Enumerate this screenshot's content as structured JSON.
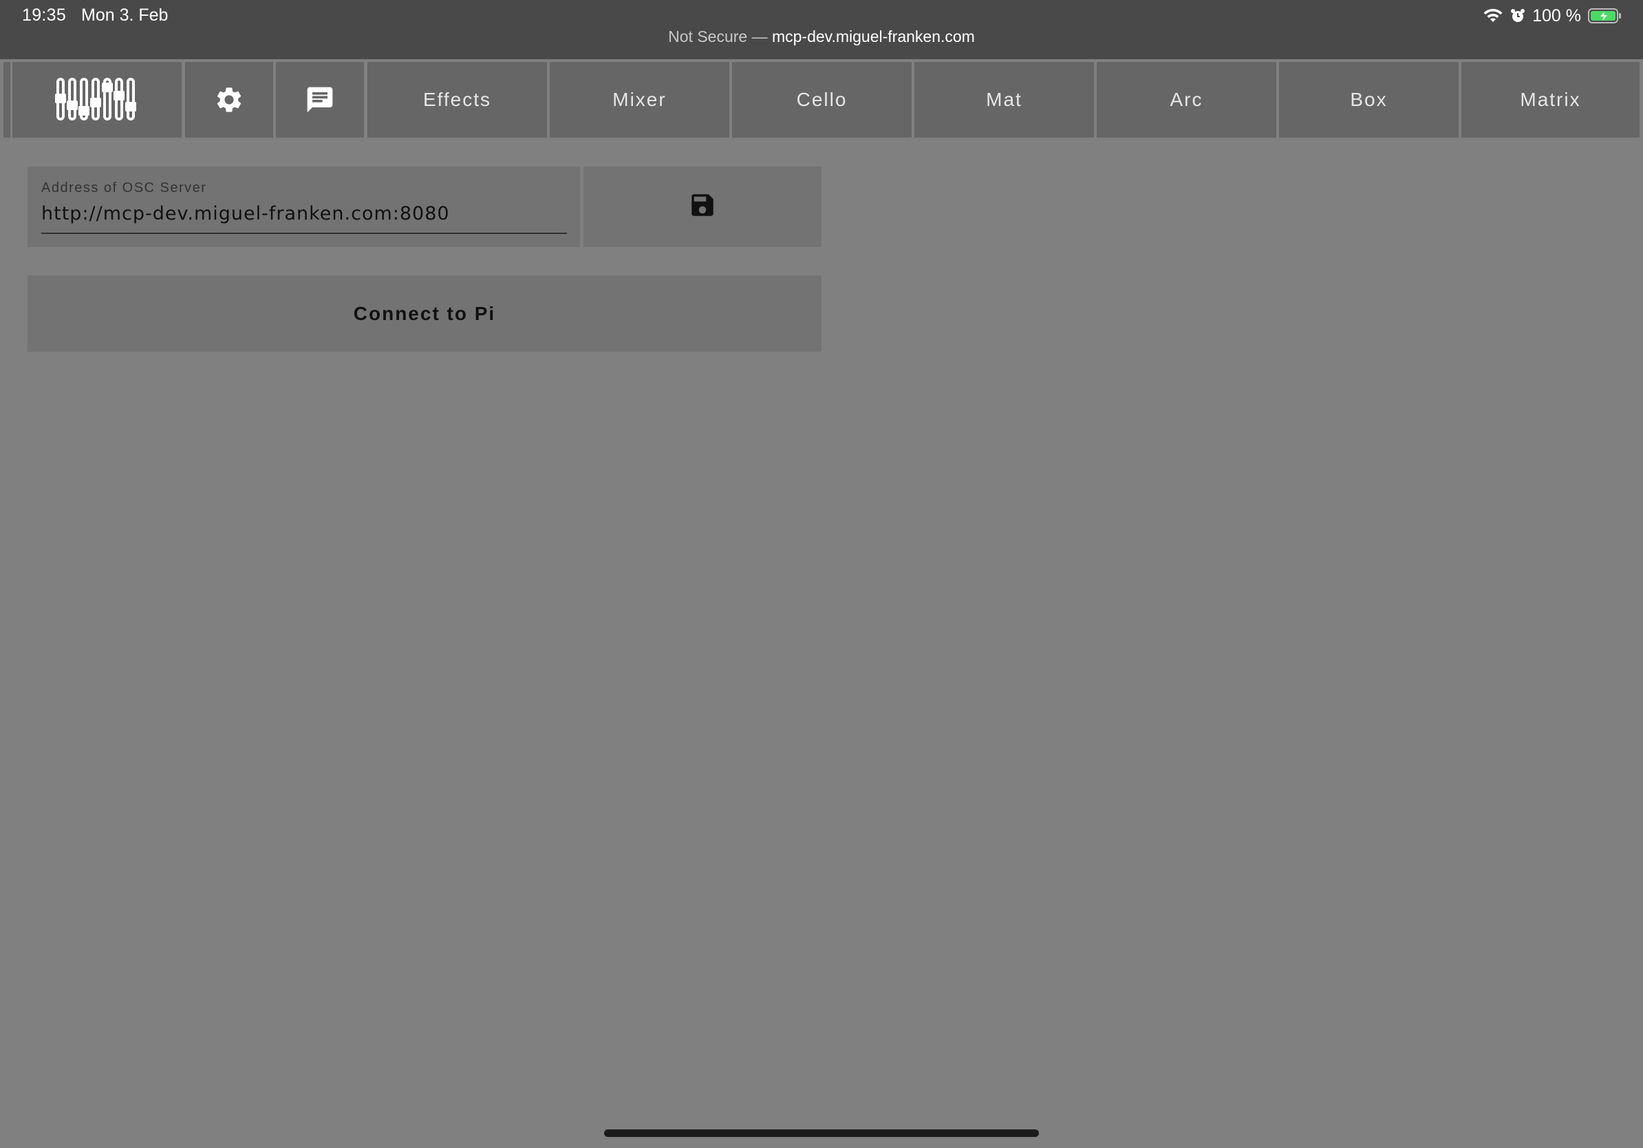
{
  "status_bar": {
    "time": "19:35",
    "date": "Mon 3. Feb",
    "security": "Not Secure —",
    "domain": "mcp-dev.miguel-franken.com",
    "battery": "100 %"
  },
  "nav": {
    "logo_icon": "mixer-faders-icon",
    "settings_icon": "gear-icon",
    "messages_icon": "chat-icon",
    "tabs": [
      "Effects",
      "Mixer",
      "Cello",
      "Mat",
      "Arc",
      "Box",
      "Matrix"
    ]
  },
  "settings": {
    "address_label": "Address of OSC Server",
    "address_value": "http://mcp-dev.miguel-franken.com:8080",
    "save_icon": "floppy-disk-icon",
    "connect_label": "Connect to Pi"
  },
  "colors": {
    "background": "#808080",
    "status_bar": "#494949",
    "tab": "#666666",
    "card": "#737373",
    "battery": "#4cd964"
  }
}
